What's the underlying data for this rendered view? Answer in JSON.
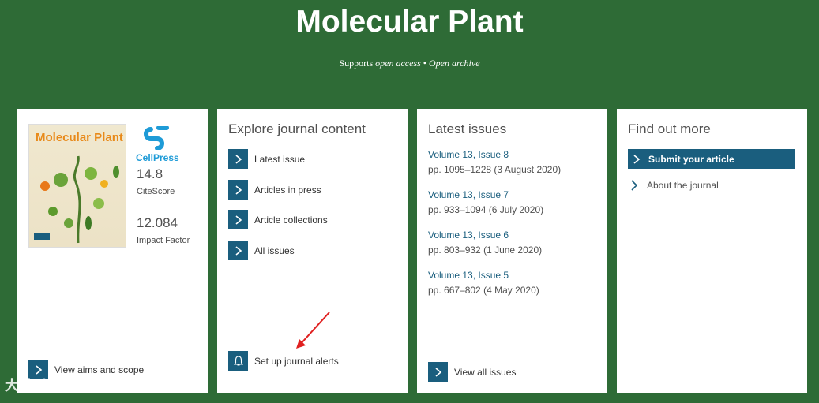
{
  "header": {
    "title": "Molecular Plant",
    "subtitle_prefix": "Supports ",
    "subtitle_open_access": "open access",
    "subtitle_sep": " • ",
    "subtitle_open_archive": "Open archive"
  },
  "card1": {
    "cover_title": "Molecular Plant",
    "cellpress": "CellPress",
    "citescore_value": "14.8",
    "citescore_label": "CiteScore",
    "impact_value": "12.084",
    "impact_label": "Impact Factor",
    "view_aims": "View aims and scope"
  },
  "card2": {
    "heading": "Explore journal content",
    "links": [
      "Latest issue",
      "Articles in press",
      "Article collections",
      "All issues"
    ],
    "alerts": "Set up journal alerts"
  },
  "card3": {
    "heading": "Latest issues",
    "issues": [
      {
        "volume": "Volume 13, Issue 8",
        "pages": "pp. 1095–1228 (3 August 2020)"
      },
      {
        "volume": "Volume 13, Issue 7",
        "pages": "pp. 933–1094 (6 July 2020)"
      },
      {
        "volume": "Volume 13, Issue 6",
        "pages": "pp. 803–932 (1 June 2020)"
      },
      {
        "volume": "Volume 13, Issue 5",
        "pages": "pp. 667–802 (4 May 2020)"
      }
    ],
    "view_all": "View all issues"
  },
  "card4": {
    "heading": "Find out more",
    "submit": "Submit your article",
    "about": "About the journal"
  },
  "watermark": "大数跨境",
  "colors": {
    "background": "#2e6b36",
    "accent": "#1a5e7e",
    "annotation_arrow": "#e02020"
  }
}
